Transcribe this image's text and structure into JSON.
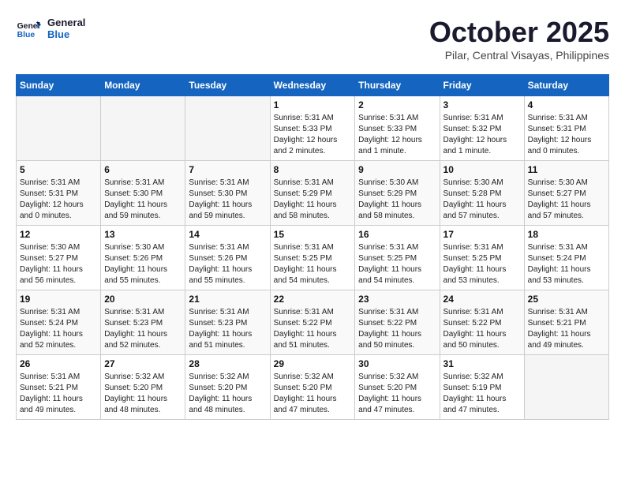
{
  "header": {
    "logo_line1": "General",
    "logo_line2": "Blue",
    "month": "October 2025",
    "location": "Pilar, Central Visayas, Philippines"
  },
  "weekdays": [
    "Sunday",
    "Monday",
    "Tuesday",
    "Wednesday",
    "Thursday",
    "Friday",
    "Saturday"
  ],
  "weeks": [
    [
      {
        "day": "",
        "info": ""
      },
      {
        "day": "",
        "info": ""
      },
      {
        "day": "",
        "info": ""
      },
      {
        "day": "1",
        "info": "Sunrise: 5:31 AM\nSunset: 5:33 PM\nDaylight: 12 hours and 2 minutes."
      },
      {
        "day": "2",
        "info": "Sunrise: 5:31 AM\nSunset: 5:33 PM\nDaylight: 12 hours and 1 minute."
      },
      {
        "day": "3",
        "info": "Sunrise: 5:31 AM\nSunset: 5:32 PM\nDaylight: 12 hours and 1 minute."
      },
      {
        "day": "4",
        "info": "Sunrise: 5:31 AM\nSunset: 5:31 PM\nDaylight: 12 hours and 0 minutes."
      }
    ],
    [
      {
        "day": "5",
        "info": "Sunrise: 5:31 AM\nSunset: 5:31 PM\nDaylight: 12 hours and 0 minutes."
      },
      {
        "day": "6",
        "info": "Sunrise: 5:31 AM\nSunset: 5:30 PM\nDaylight: 11 hours and 59 minutes."
      },
      {
        "day": "7",
        "info": "Sunrise: 5:31 AM\nSunset: 5:30 PM\nDaylight: 11 hours and 59 minutes."
      },
      {
        "day": "8",
        "info": "Sunrise: 5:31 AM\nSunset: 5:29 PM\nDaylight: 11 hours and 58 minutes."
      },
      {
        "day": "9",
        "info": "Sunrise: 5:30 AM\nSunset: 5:29 PM\nDaylight: 11 hours and 58 minutes."
      },
      {
        "day": "10",
        "info": "Sunrise: 5:30 AM\nSunset: 5:28 PM\nDaylight: 11 hours and 57 minutes."
      },
      {
        "day": "11",
        "info": "Sunrise: 5:30 AM\nSunset: 5:27 PM\nDaylight: 11 hours and 57 minutes."
      }
    ],
    [
      {
        "day": "12",
        "info": "Sunrise: 5:30 AM\nSunset: 5:27 PM\nDaylight: 11 hours and 56 minutes."
      },
      {
        "day": "13",
        "info": "Sunrise: 5:30 AM\nSunset: 5:26 PM\nDaylight: 11 hours and 55 minutes."
      },
      {
        "day": "14",
        "info": "Sunrise: 5:31 AM\nSunset: 5:26 PM\nDaylight: 11 hours and 55 minutes."
      },
      {
        "day": "15",
        "info": "Sunrise: 5:31 AM\nSunset: 5:25 PM\nDaylight: 11 hours and 54 minutes."
      },
      {
        "day": "16",
        "info": "Sunrise: 5:31 AM\nSunset: 5:25 PM\nDaylight: 11 hours and 54 minutes."
      },
      {
        "day": "17",
        "info": "Sunrise: 5:31 AM\nSunset: 5:25 PM\nDaylight: 11 hours and 53 minutes."
      },
      {
        "day": "18",
        "info": "Sunrise: 5:31 AM\nSunset: 5:24 PM\nDaylight: 11 hours and 53 minutes."
      }
    ],
    [
      {
        "day": "19",
        "info": "Sunrise: 5:31 AM\nSunset: 5:24 PM\nDaylight: 11 hours and 52 minutes."
      },
      {
        "day": "20",
        "info": "Sunrise: 5:31 AM\nSunset: 5:23 PM\nDaylight: 11 hours and 52 minutes."
      },
      {
        "day": "21",
        "info": "Sunrise: 5:31 AM\nSunset: 5:23 PM\nDaylight: 11 hours and 51 minutes."
      },
      {
        "day": "22",
        "info": "Sunrise: 5:31 AM\nSunset: 5:22 PM\nDaylight: 11 hours and 51 minutes."
      },
      {
        "day": "23",
        "info": "Sunrise: 5:31 AM\nSunset: 5:22 PM\nDaylight: 11 hours and 50 minutes."
      },
      {
        "day": "24",
        "info": "Sunrise: 5:31 AM\nSunset: 5:22 PM\nDaylight: 11 hours and 50 minutes."
      },
      {
        "day": "25",
        "info": "Sunrise: 5:31 AM\nSunset: 5:21 PM\nDaylight: 11 hours and 49 minutes."
      }
    ],
    [
      {
        "day": "26",
        "info": "Sunrise: 5:31 AM\nSunset: 5:21 PM\nDaylight: 11 hours and 49 minutes."
      },
      {
        "day": "27",
        "info": "Sunrise: 5:32 AM\nSunset: 5:20 PM\nDaylight: 11 hours and 48 minutes."
      },
      {
        "day": "28",
        "info": "Sunrise: 5:32 AM\nSunset: 5:20 PM\nDaylight: 11 hours and 48 minutes."
      },
      {
        "day": "29",
        "info": "Sunrise: 5:32 AM\nSunset: 5:20 PM\nDaylight: 11 hours and 47 minutes."
      },
      {
        "day": "30",
        "info": "Sunrise: 5:32 AM\nSunset: 5:20 PM\nDaylight: 11 hours and 47 minutes."
      },
      {
        "day": "31",
        "info": "Sunrise: 5:32 AM\nSunset: 5:19 PM\nDaylight: 11 hours and 47 minutes."
      },
      {
        "day": "",
        "info": ""
      }
    ]
  ]
}
